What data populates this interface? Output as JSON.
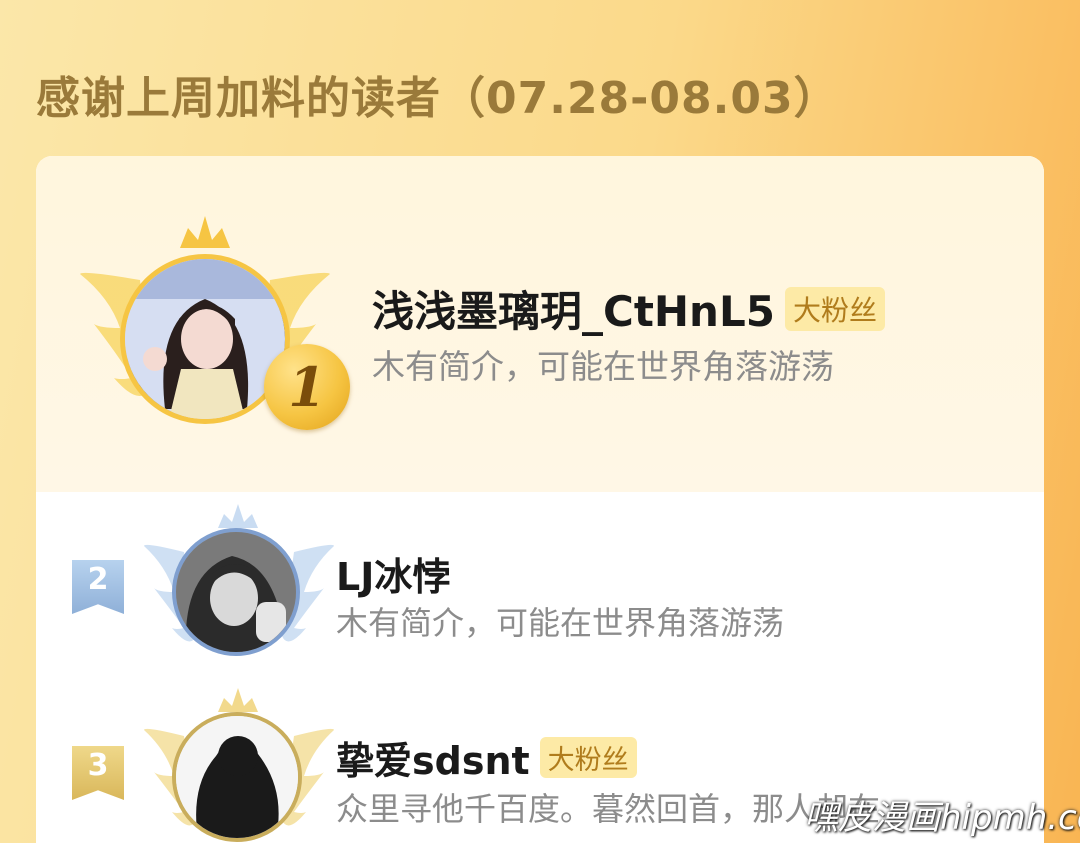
{
  "header": {
    "title": "感谢上周加料的读者（07.28-08.03）"
  },
  "ranking": [
    {
      "rank": "1",
      "name": "浅浅墨璃玥_CtHnL5",
      "badge": "大粉丝",
      "bio": "木有简介，可能在世界角落游荡",
      "avatar_icon": "avatar-girl-dark-hair"
    },
    {
      "rank": "2",
      "name": "LJ冰悖",
      "badge": "",
      "bio": "木有简介，可能在世界角落游荡",
      "avatar_icon": "avatar-girl-grayscale"
    },
    {
      "rank": "3",
      "name": "挚爱sdsnt",
      "badge": "大粉丝",
      "bio": "众里寻他千百度。暮然回首，那人却在",
      "avatar_icon": "avatar-silhouette"
    }
  ],
  "watermark": "嘿皮漫画hipmh.com",
  "colors": {
    "gold": "#f6c543",
    "silver": "#9fbfe0",
    "bronze": "#e9cf7a",
    "badge_bg": "#fdeaa6",
    "badge_text": "#b07c1c"
  }
}
